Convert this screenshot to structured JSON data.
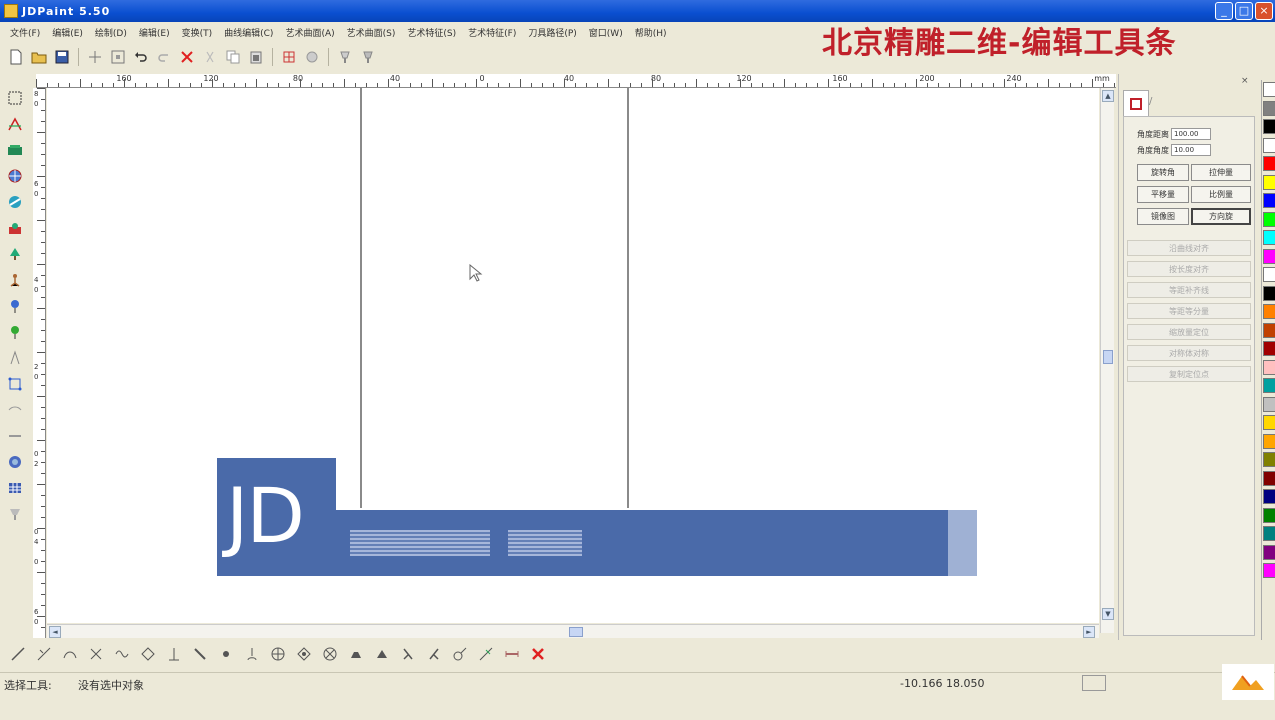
{
  "window": {
    "title": "JDPaint 5.50",
    "controls": [
      "_",
      "□",
      "×"
    ]
  },
  "overlay_caption": "北京精雕二维-编辑工具条",
  "menu": [
    "文件(F)",
    "编辑(E)",
    "绘制(D)",
    "编辑(E)",
    "变换(T)",
    "曲线编辑(C)",
    "艺术曲面(A)",
    "艺术曲面(S)",
    "艺术特征(S)",
    "艺术特征(F)",
    "刀具路径(P)",
    "窗口(W)",
    "帮助(H)"
  ],
  "toolbar_icons": [
    "new-file",
    "open-file",
    "save-file",
    "crosshair",
    "snap-grid",
    "undo",
    "redo",
    "delete",
    "cut",
    "copy",
    "paste",
    "array",
    "clear",
    "lamp-on",
    "lamp-off"
  ],
  "ruler": {
    "top_labels": [
      "160",
      "120",
      "80",
      "40",
      "0",
      "40",
      "80",
      "120",
      "160",
      "200",
      "240",
      "mm"
    ],
    "left_labels": [
      "8",
      "0",
      "6",
      "0",
      "4",
      "0",
      "2",
      "0",
      "0",
      "2",
      "0",
      "4",
      "0",
      "6",
      "0"
    ]
  },
  "left_tools": [
    "select",
    "curve",
    "text",
    "globe",
    "layers",
    "chart",
    "tree",
    "figure",
    "pin-blue",
    "pin-green",
    "knife",
    "transform",
    "frame",
    "line-tool",
    "gem",
    "grid",
    "lamp"
  ],
  "panel": {
    "tab_icon": "square-icon",
    "tab_mark": "/",
    "close": "×",
    "fields": [
      {
        "label": "角度距离",
        "value": "100.00"
      },
      {
        "label": "角度角度",
        "value": "10.00"
      }
    ],
    "buttons": [
      [
        "旋转角",
        "拉伸量"
      ],
      [
        "平移量",
        "比例量"
      ],
      [
        "镜像图",
        "方向旋"
      ]
    ],
    "disabled_buttons": [
      "沿曲线对齐",
      "按长度对齐",
      "等距补齐线",
      "等距等分量",
      "缩放量定位",
      "对称体对称",
      "复制定位点"
    ]
  },
  "palette": [
    "#ffffff",
    "#808080",
    "#000000",
    "#ffffff",
    "#ff0000",
    "#ffff00",
    "#0000ff",
    "#00ff00",
    "#00ffff",
    "#ff00ff",
    "#ffffff",
    "#000000",
    "#ff8000",
    "#c04000",
    "#a00000",
    "#ffc0c0",
    "#00a0a0",
    "#c0c0c0",
    "#ffd700",
    "#ffa500",
    "#808000",
    "#800000",
    "#000080",
    "#008000",
    "#008080",
    "#800080",
    "#ff00ff"
  ],
  "bottom_tools": [
    "line-edit",
    "trim",
    "arc-edit",
    "cross",
    "wave",
    "diamond",
    "anchor",
    "corner",
    "dot",
    "pen",
    "node-a",
    "node-b",
    "node-c",
    "node-d",
    "hand-a",
    "hand-b",
    "pin-a",
    "pin-b",
    "bend",
    "cut-line",
    "x-close"
  ],
  "status": {
    "tool": "选择工具:",
    "message": "没有选中对象",
    "coords": "-10.166 18.050"
  },
  "watermark": {
    "logo": "JD"
  }
}
